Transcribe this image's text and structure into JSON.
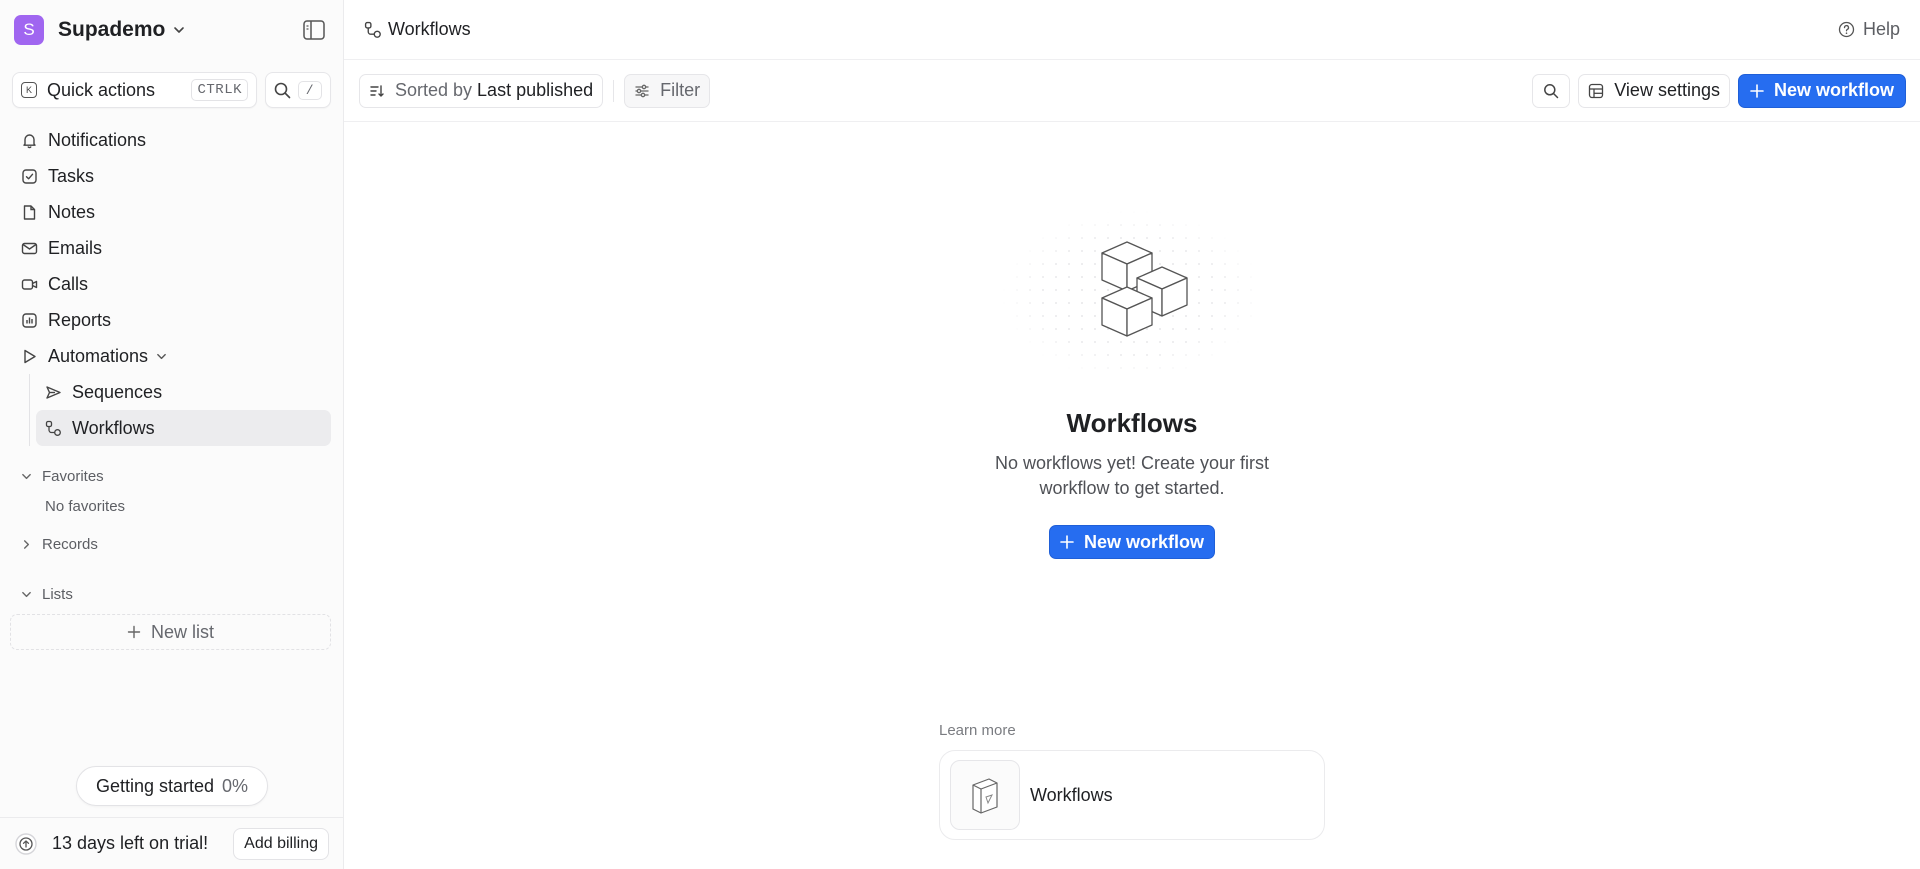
{
  "workspace": {
    "initial": "S",
    "name": "Supademo",
    "avatar_color": "#a066f0"
  },
  "quick_actions": {
    "label": "Quick actions",
    "shortcut": "CTRLK",
    "search_shortcut": "/"
  },
  "nav": {
    "notifications": "Notifications",
    "tasks": "Tasks",
    "notes": "Notes",
    "emails": "Emails",
    "calls": "Calls",
    "reports": "Reports",
    "automations": "Automations",
    "sequences": "Sequences",
    "workflows": "Workflows"
  },
  "sections": {
    "favorites": {
      "label": "Favorites",
      "empty": "No favorites"
    },
    "records": {
      "label": "Records"
    },
    "lists": {
      "label": "Lists",
      "new_list": "New list"
    }
  },
  "getting_started": {
    "label": "Getting started",
    "percent": "0%"
  },
  "trial": {
    "text": "13 days left on trial!",
    "billing_button": "Add billing"
  },
  "topbar": {
    "breadcrumb": "Workflows",
    "help": "Help"
  },
  "toolbar": {
    "sort_prefix": "Sorted by",
    "sort_value": "Last published",
    "filter": "Filter",
    "view_settings": "View settings",
    "new_workflow": "New workflow"
  },
  "empty_state": {
    "title": "Workflows",
    "description": "No workflows yet! Create your first workflow to get started.",
    "button": "New workflow"
  },
  "learn_more": {
    "label": "Learn more",
    "card_title": "Workflows"
  },
  "colors": {
    "primary": "#266df0",
    "active_nav_bg": "#ececee"
  }
}
